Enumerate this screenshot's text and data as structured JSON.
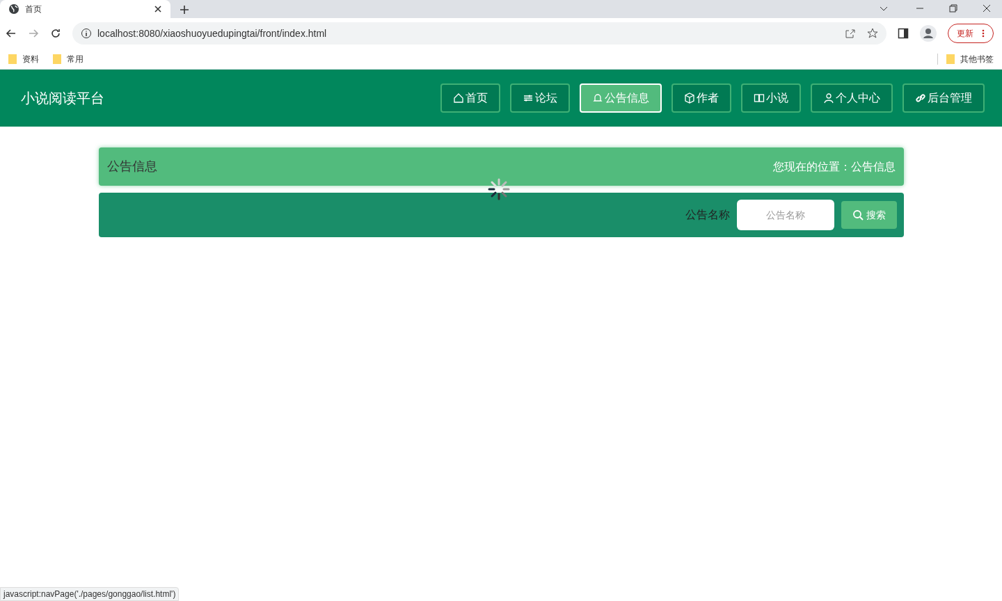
{
  "browser": {
    "tab_title": "首页",
    "url": "localhost:8080/xiaoshuoyuedupingtai/front/index.html",
    "update_button": "更新",
    "bookmarks": [
      "资料",
      "常用"
    ],
    "other_bookmarks": "其他书签"
  },
  "header": {
    "site_title": "小说阅读平台",
    "nav": [
      {
        "label": "首页",
        "kind": "home",
        "selected": false
      },
      {
        "label": "论坛",
        "kind": "sliders",
        "selected": false
      },
      {
        "label": "公告信息",
        "kind": "bell",
        "selected": true
      },
      {
        "label": "作者",
        "kind": "cube",
        "selected": false
      },
      {
        "label": "小说",
        "kind": "book",
        "selected": false
      },
      {
        "label": "个人中心",
        "kind": "user",
        "selected": false
      },
      {
        "label": "后台管理",
        "kind": "link",
        "selected": false
      }
    ]
  },
  "page_title_bar": {
    "title": "公告信息",
    "breadcrumb": "您现在的位置：公告信息"
  },
  "search_bar": {
    "label": "公告名称",
    "placeholder": "公告名称",
    "button": "搜索"
  },
  "status_bar": "javascript:navPage('./pages/gonggao/list.html')"
}
